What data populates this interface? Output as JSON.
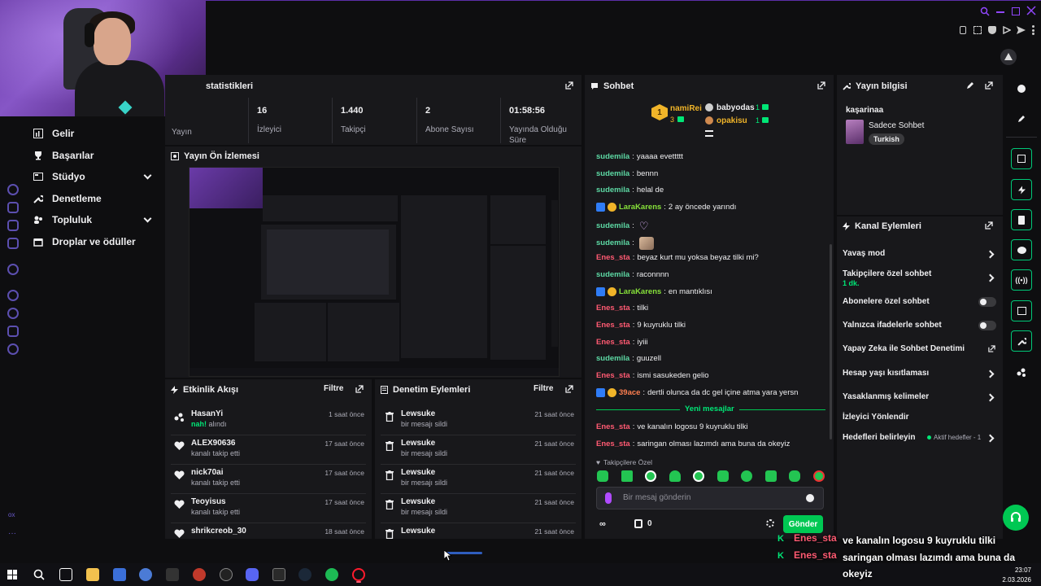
{
  "stats": {
    "title": "statistikleri",
    "items": [
      {
        "value": "",
        "label": "Yayın"
      },
      {
        "value": "16",
        "label": "İzleyici"
      },
      {
        "value": "1.440",
        "label": "Takipçi"
      },
      {
        "value": "2",
        "label": "Abone Sayısı"
      },
      {
        "value": "01:58:56",
        "label": "Yayında Olduğu Süre"
      }
    ]
  },
  "sidebar": {
    "items": [
      {
        "label": "Gelir",
        "icon": "chart-icon",
        "expand": false
      },
      {
        "label": "Başarılar",
        "icon": "trophy-icon",
        "expand": false
      },
      {
        "label": "Stüdyo",
        "icon": "studio-icon",
        "expand": true
      },
      {
        "label": "Denetleme",
        "icon": "wrench-icon",
        "expand": false
      },
      {
        "label": "Topluluk",
        "icon": "community-icon",
        "expand": true
      },
      {
        "label": "Droplar ve ödüller",
        "icon": "gift-icon",
        "expand": false
      }
    ],
    "bottom_label": "ox"
  },
  "preview": {
    "title": "Yayın Ön İzlemesi"
  },
  "activity": {
    "title": "Etkinlik Akışı",
    "filter": "Filtre",
    "items": [
      {
        "name": "HasanYi",
        "sub_accent": "nah!",
        "sub": " alındı",
        "time": "1 saat önce",
        "icon": "points-icon"
      },
      {
        "name": "ALEX90636",
        "sub_accent": "",
        "sub": "kanalı takip etti",
        "time": "17 saat önce",
        "icon": "heart-icon"
      },
      {
        "name": "nick70ai",
        "sub_accent": "",
        "sub": "kanalı takip etti",
        "time": "17 saat önce",
        "icon": "heart-icon"
      },
      {
        "name": "Teoyisus",
        "sub_accent": "",
        "sub": "kanalı takip etti",
        "time": "17 saat önce",
        "icon": "heart-icon"
      },
      {
        "name": "shrikcreob_30",
        "sub_accent": "",
        "sub": "",
        "time": "18 saat önce",
        "icon": "heart-icon"
      }
    ]
  },
  "moderation": {
    "title": "Denetim Eylemleri",
    "filter": "Filtre",
    "items": [
      {
        "name": "Lewsuke",
        "sub": "bir mesajı sildi",
        "time": "21 saat önce"
      },
      {
        "name": "Lewsuke",
        "sub": "bir mesajı sildi",
        "time": "21 saat önce"
      },
      {
        "name": "Lewsuke",
        "sub": "bir mesajı sildi",
        "time": "21 saat önce"
      },
      {
        "name": "Lewsuke",
        "sub": "bir mesajı sildi",
        "time": "21 saat önce"
      },
      {
        "name": "Lewsuke",
        "sub": "",
        "time": "21 saat önce"
      }
    ]
  },
  "chat": {
    "title": "Sohbet",
    "leaderboard": [
      {
        "rank": "1",
        "name": "namiRei",
        "count": "3"
      },
      {
        "rank": "",
        "name": "babyodas",
        "count": "1"
      },
      {
        "rank": "",
        "name": "opakisu",
        "count": "1"
      }
    ],
    "messages": [
      {
        "user": "sudemila",
        "color": "green",
        "text": "yaaaa evettttt",
        "badges": false
      },
      {
        "user": "sudemila",
        "color": "green",
        "text": "bennn",
        "badges": false
      },
      {
        "user": "sudemila",
        "color": "green",
        "text": "helal de",
        "badges": false
      },
      {
        "user": "LaraKarens",
        "color": "lime",
        "text": "2 ay öncede yarındı",
        "badges": true
      },
      {
        "user": "sudemila",
        "color": "green",
        "text": "",
        "badges": false,
        "emote": "heart-emote"
      },
      {
        "user": "sudemila",
        "color": "green",
        "text": "",
        "badges": false,
        "emote": "cat-emote"
      },
      {
        "user": "Enes_sta",
        "color": "red",
        "text": "beyaz kurt mu yoksa beyaz tilki mi?",
        "badges": false
      },
      {
        "user": "sudemila",
        "color": "green",
        "text": "raconnnn",
        "badges": false
      },
      {
        "user": "LaraKarens",
        "color": "lime",
        "text": "en mantıklısı",
        "badges": true
      },
      {
        "user": "Enes_sta",
        "color": "red",
        "text": "tilki",
        "badges": false
      },
      {
        "user": "Enes_sta",
        "color": "red",
        "text": "9 kuyruklu tilki",
        "badges": false
      },
      {
        "user": "Enes_sta",
        "color": "red",
        "text": "iyiii",
        "badges": false
      },
      {
        "user": "sudemila",
        "color": "green",
        "text": "guuzell",
        "badges": false
      },
      {
        "user": "Enes_sta",
        "color": "red",
        "text": "ismi sasukeden gelio",
        "badges": false
      },
      {
        "user": "39ace",
        "color": "orange",
        "text": "dertli olunca da dc gel içine atma yara yersn",
        "badges": true
      }
    ],
    "new_messages_label": "Yeni mesajlar",
    "new_messages": [
      {
        "user": "Enes_sta",
        "color": "red",
        "text": "ve kanalın logosu 9 kuyruklu tilki"
      },
      {
        "user": "Enes_sta",
        "color": "red",
        "text": "saringan olması lazımdı ama buna da okeyiz"
      }
    ],
    "followers_only": "Takipçilere Özel",
    "input_placeholder": "Bir mesaj gönderin",
    "points": "0",
    "send_label": "Gönder"
  },
  "stream_info": {
    "title": "Yayın bilgisi",
    "stream_title": "kaşarinaa",
    "category": "Sadece Sohbet",
    "tag": "Turkish"
  },
  "channel_actions": {
    "title": "Kanal Eylemleri",
    "items": [
      {
        "label": "Yavaş mod",
        "sub": "",
        "control": "chevron"
      },
      {
        "label": "Takipçilere özel sohbet",
        "sub": "1 dk.",
        "control": "chevron"
      },
      {
        "label": "Abonelere özel sohbet",
        "sub": "",
        "control": "toggle"
      },
      {
        "label": "Yalnızca ifadelerle sohbet",
        "sub": "",
        "control": "toggle"
      },
      {
        "label": "Yapay Zeka ile Sohbet Denetimi",
        "sub": "",
        "control": "external"
      },
      {
        "label": "Hesap yaşı kısıtlaması",
        "sub": "",
        "control": "chevron"
      },
      {
        "label": "Yasaklanmış kelimeler",
        "sub": "",
        "control": "chevron"
      },
      {
        "label": "İzleyici Yönlendir",
        "sub": "",
        "control": "none"
      },
      {
        "label": "Hedefleri belirleyin",
        "sub": "",
        "control": "chevron",
        "status": "Aktif hedefler - 1"
      }
    ]
  },
  "overlay_chat": [
    {
      "user": "Enes_sta",
      "text": "ve kanalın logosu 9 kuyruklu tilki"
    },
    {
      "user": "Enes_sta",
      "text": "saringan olması lazımdı ama buna da okeyiz"
    }
  ],
  "taskbar": {
    "time": "23:07",
    "date": "2.03.2026"
  },
  "colors": {
    "accent_purple": "#9147ff",
    "accent_green": "#00c878",
    "username_green": "#5dd9a4",
    "username_red": "#ff5a72",
    "username_lime": "#87e23a"
  }
}
